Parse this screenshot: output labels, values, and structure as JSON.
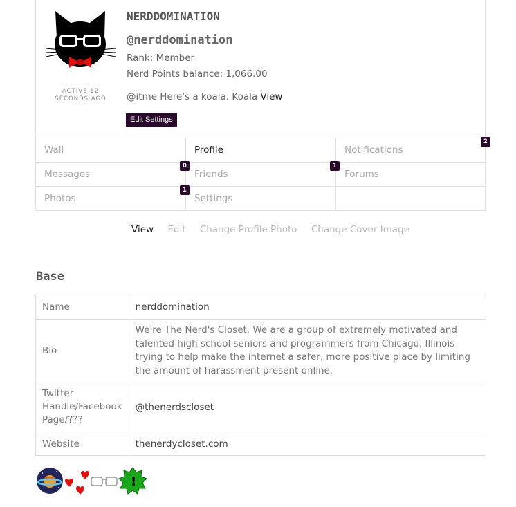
{
  "profile": {
    "display_name": "NERDDOMINATION",
    "handle": "@nerddomination",
    "rank": "Rank: Member",
    "points": "Nerd Points balance: 1,066.00",
    "active_status": "Active 12 seconds ago",
    "activity_text": "@itme Here's a koala. Koala",
    "activity_link": "View",
    "edit_settings": "Edit Settings"
  },
  "nav": [
    {
      "label": "Wall"
    },
    {
      "label": "Profile",
      "active": true
    },
    {
      "label": "Notifications",
      "badge": "2"
    },
    {
      "label": "Messages",
      "badge": "0"
    },
    {
      "label": "Friends",
      "badge": "1"
    },
    {
      "label": "Forums"
    },
    {
      "label": "Photos",
      "badge": "1"
    },
    {
      "label": "Settings"
    },
    {
      "label": ""
    }
  ],
  "subnav": [
    "View",
    "Edit",
    "Change Profile Photo",
    "Change Cover Image"
  ],
  "section": {
    "title": "Base"
  },
  "fields": [
    {
      "label": "Name",
      "value": "nerddomination"
    },
    {
      "label": "Bio",
      "value": "We're The Nerd's Closet. We are a group of extremely motivated and talented high school seniors and programmers from Chicago, Illinois trying to help make the internet a safer, more positive place by limiting the amount of harassment present online."
    },
    {
      "label": "Twitter Handle/Facebook Page/???",
      "value": "@thenerdscloset"
    },
    {
      "label": "Website",
      "value": "thenerdycloset.com"
    }
  ],
  "badge_icons": [
    "planet-icon",
    "hearts-icon",
    "glasses-icon",
    "exclamation-burst-icon"
  ],
  "colors": {
    "accent": "#2a0a2a",
    "burst": "#1aa81a",
    "heart": "#e01010",
    "planet": "#22265a"
  }
}
